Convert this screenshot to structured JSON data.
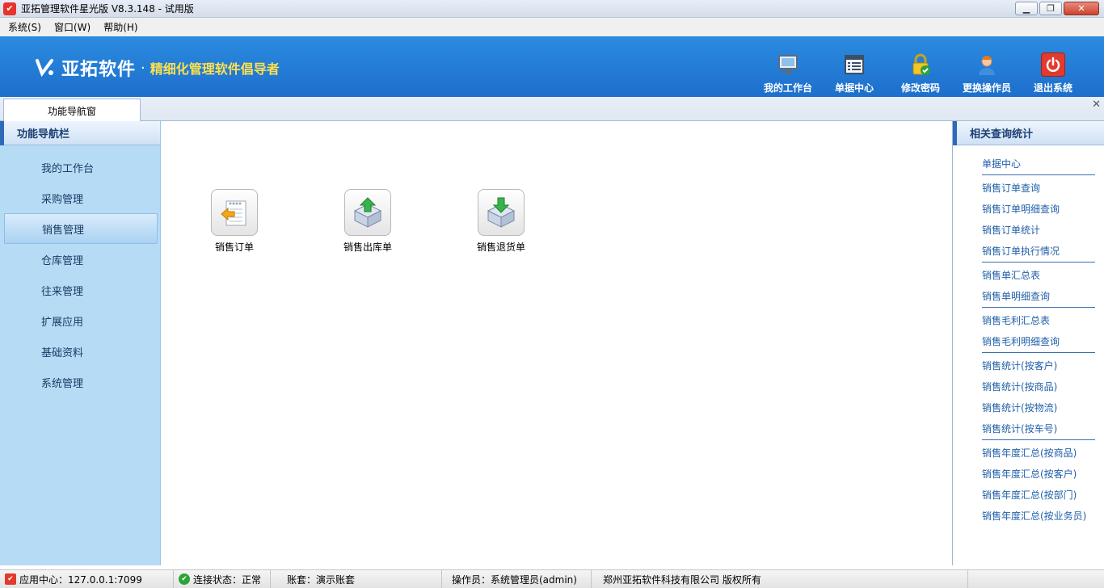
{
  "window": {
    "title": "亚拓管理软件星光版 V8.3.148 - 试用版"
  },
  "menu": [
    {
      "label": "系统(S)"
    },
    {
      "label": "窗口(W)"
    },
    {
      "label": "帮助(H)"
    }
  ],
  "banner": {
    "brand": "亚拓软件",
    "dot": "·",
    "slogan": "精细化管理软件倡导者",
    "tools": [
      {
        "label": "我的工作台",
        "icon": "monitor-icon"
      },
      {
        "label": "单据中心",
        "icon": "document-list-icon"
      },
      {
        "label": "修改密码",
        "icon": "lock-icon"
      },
      {
        "label": "更换操作员",
        "icon": "user-icon"
      },
      {
        "label": "退出系统",
        "icon": "power-icon"
      }
    ]
  },
  "tabs": [
    {
      "label": "功能导航窗"
    }
  ],
  "left_nav": {
    "header": "功能导航栏",
    "items": [
      {
        "label": "我的工作台"
      },
      {
        "label": "采购管理"
      },
      {
        "label": "销售管理",
        "active": true
      },
      {
        "label": "仓库管理"
      },
      {
        "label": "往来管理"
      },
      {
        "label": "扩展应用"
      },
      {
        "label": "基础资料"
      },
      {
        "label": "系统管理"
      }
    ]
  },
  "functions": [
    {
      "label": "销售订单",
      "icon": "sales-order-icon"
    },
    {
      "label": "销售出库单",
      "icon": "box-out-icon"
    },
    {
      "label": "销售退货单",
      "icon": "box-return-icon"
    }
  ],
  "right_panel": {
    "header": "相关查询统计",
    "groups": [
      [
        "单据中心"
      ],
      [
        "销售订单查询",
        "销售订单明细查询",
        "销售订单统计",
        "销售订单执行情况"
      ],
      [
        "销售单汇总表",
        "销售单明细查询"
      ],
      [
        "销售毛利汇总表",
        "销售毛利明细查询"
      ],
      [
        "销售统计(按客户)",
        "销售统计(按商品)",
        "销售统计(按物流)",
        "销售统计(按车号)"
      ],
      [
        "销售年度汇总(按商品)",
        "销售年度汇总(按客户)",
        "销售年度汇总(按部门)",
        "销售年度汇总(按业务员)"
      ]
    ]
  },
  "status": {
    "center": "应用中心：127.0.0.1:7099",
    "connection": "连接状态：正常",
    "account": "账套：演示账套",
    "operator": "操作员：系统管理员(admin)",
    "copyright": "郑州亚拓软件科技有限公司 版权所有"
  },
  "colors": {
    "banner": "#1d6fcc",
    "nav_bg": "#b6dcf5",
    "link": "#1f5fa8",
    "slogan": "#ffe14a"
  }
}
